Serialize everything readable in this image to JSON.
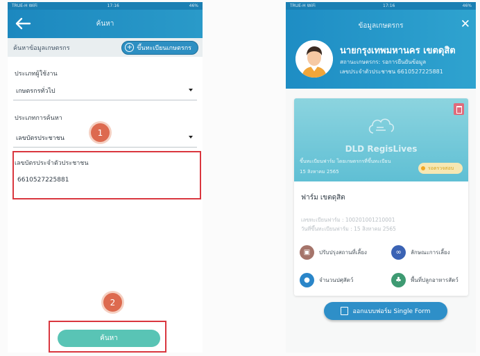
{
  "left_screen": {
    "status": {
      "carrier": "TRUE-H WiFi",
      "time": "17:16",
      "battery": "46%"
    },
    "appbar": {
      "title": "ค้นหา"
    },
    "subheader": {
      "label": "ค้นหาข้อมูลเกษตรกร",
      "add_button": "ขึ้นทะเบียนเกษตรกร"
    },
    "user_type": {
      "label": "ประเภทผู้ใช้งาน",
      "value": "เกษตรกรทั่วไป"
    },
    "search_type": {
      "label": "ประเภทการค้นหา",
      "value": "เลขบัตรประชาชน"
    },
    "id_field": {
      "label": "เลขบัตรประจำตัวประชาชน",
      "value": "6610527225881"
    },
    "markers": {
      "one": "1",
      "two": "2"
    },
    "search_button": "ค้นหา"
  },
  "right_screen": {
    "status": {
      "carrier": "TRUE-H WiFi",
      "time": "17:16",
      "battery": "46%"
    },
    "appbar": {
      "title": "ข้อมูลเกษตรกร"
    },
    "profile": {
      "name": "นายกรุงเทพมหานคร เขตดุสิต",
      "status": "สถานะเกษตรกร: รอการยืนยันข้อมูล",
      "id_line": "เลขประจำตัวประชาชน 6610527225881"
    },
    "banner": {
      "brand": "DLD RegisLives",
      "line1": "ขึ้นทะเบียนฟาร์ม โดยเกษตรกรที่ขึ้นทะเบียน",
      "line2": "15 สิงหาคม 2565",
      "pending_label": "รอตรวจสอบ"
    },
    "farm": {
      "name": "ฟาร์ม เขตดุสิต",
      "reg_no": "เลขทะเบียนฟาร์ม : 100201001210001",
      "reg_date": "วันที่ขึ้นทะเบียนฟาร์ม : 15 สิงหาคม 2565"
    },
    "menu": [
      {
        "label": "ปรับปรุงสถานที่เลี้ยง",
        "icon": "building-icon",
        "color": "#a5746a"
      },
      {
        "label": "ลักษณะการเลี้ยง",
        "icon": "link-icon",
        "color": "#3b63b4"
      },
      {
        "label": "จำนวนปศุสัตว์",
        "icon": "paw-icon",
        "color": "#2a86c9"
      },
      {
        "label": "พื้นที่ปลูกอาหารสัตว์",
        "icon": "leaf-icon",
        "color": "#3e9a72"
      }
    ],
    "form_button": "ออกแบบฟอร์ม Single Form"
  },
  "colors": {
    "header_blue": "#1c88bf",
    "red_highlight": "#d9363e",
    "search_teal": "#59c4b5"
  }
}
